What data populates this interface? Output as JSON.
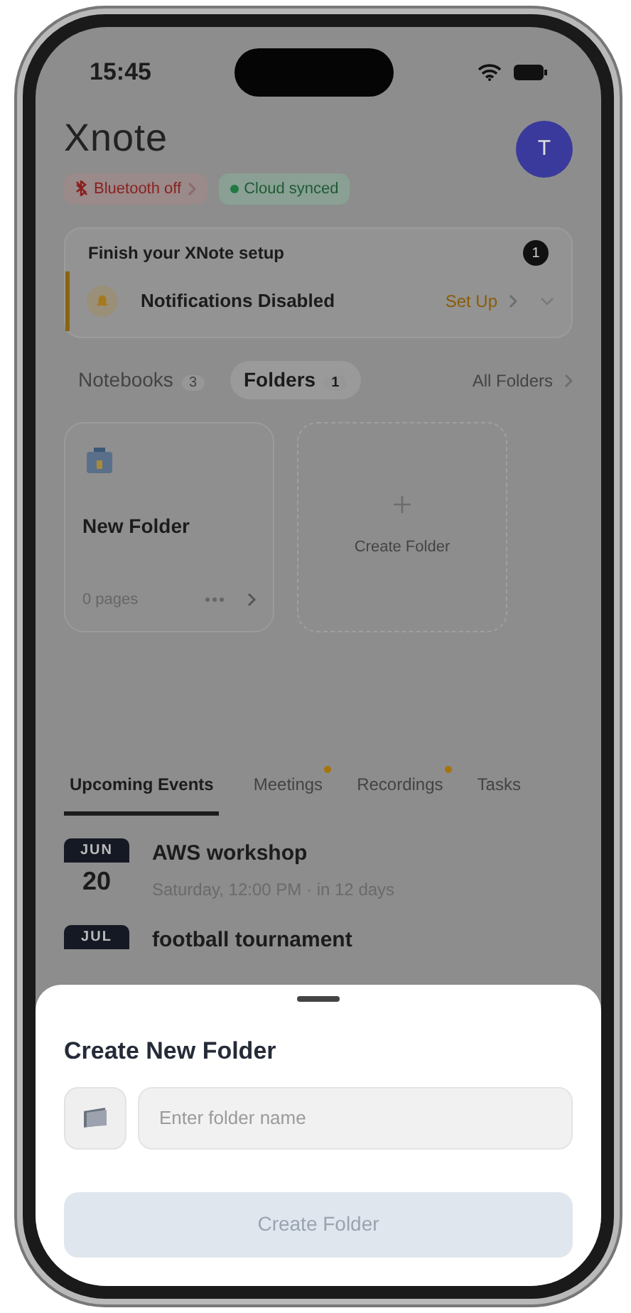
{
  "status_bar": {
    "time": "15:45"
  },
  "header": {
    "logo": "Xnote",
    "avatar": "T"
  },
  "chips": [
    {
      "label": "Bluetooth off",
      "kind": "warning"
    },
    {
      "label": "Cloud synced",
      "kind": "ok"
    }
  ],
  "setup": {
    "title": "Finish your XNote setup",
    "count": "1",
    "item": {
      "label": "Notifications Disabled",
      "action": "Set Up"
    }
  },
  "section_tabs": [
    {
      "label": "Notebooks",
      "count": "3",
      "selected": false
    },
    {
      "label": "Folders",
      "count": "1",
      "selected": true
    }
  ],
  "all_link": "All Folders",
  "folders": [
    {
      "name": "New Folder",
      "pages": "0 pages"
    }
  ],
  "create_card": {
    "label": "Create Folder"
  },
  "event_tabs": [
    {
      "label": "Upcoming Events",
      "selected": true,
      "dot": false
    },
    {
      "label": "Meetings",
      "selected": false,
      "dot": true
    },
    {
      "label": "Recordings",
      "selected": false,
      "dot": true
    },
    {
      "label": "Tasks",
      "selected": false,
      "dot": false
    }
  ],
  "events": [
    {
      "month": "JUN",
      "day": "20",
      "title": "AWS workshop",
      "subtitle": "Saturday, 12:00 PM · in 12 days"
    },
    {
      "month": "JUL",
      "title": "football tournament"
    }
  ],
  "sheet": {
    "title": "Create New Folder",
    "placeholder": "Enter folder name",
    "button": {
      "label": "Create Folder",
      "disabled": true
    }
  }
}
